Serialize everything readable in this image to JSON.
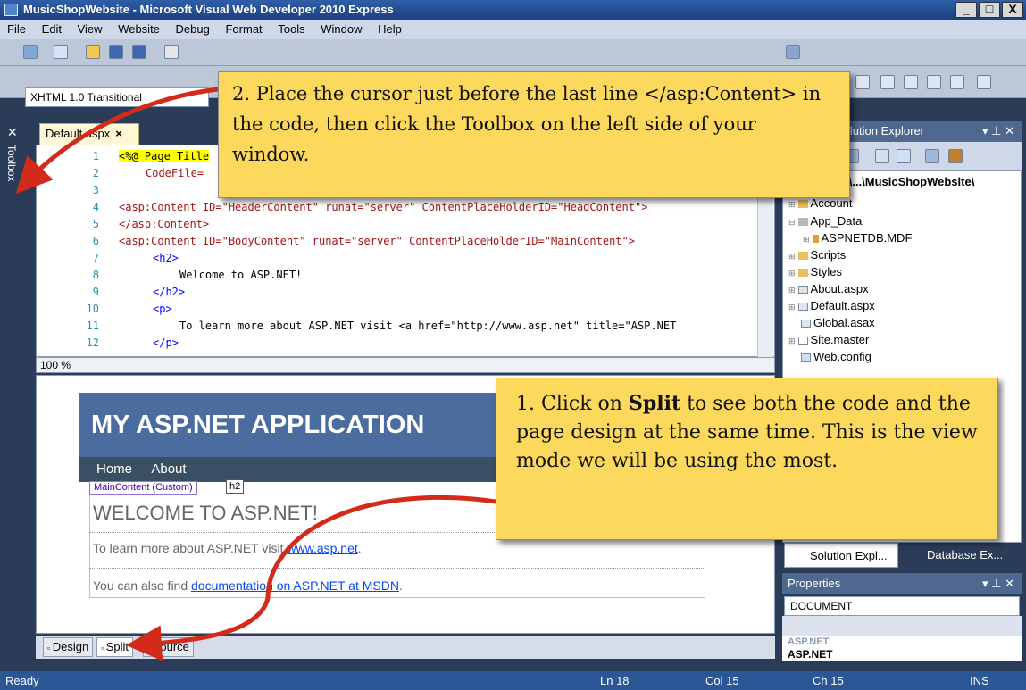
{
  "window": {
    "title": "MusicShopWebsite - Microsoft Visual Web Developer 2010 Express",
    "controls": [
      "_",
      "□",
      "X"
    ]
  },
  "menu": [
    "File",
    "Edit",
    "View",
    "Website",
    "Debug",
    "Format",
    "Tools",
    "Window",
    "Help"
  ],
  "toolbar": {
    "doctype_selected": "XHTML 1.0 Transitional"
  },
  "toolbox": {
    "label": "Toolbox"
  },
  "editor": {
    "tab_label": "Default.aspx",
    "tab_close": "×",
    "zoom": "100 %",
    "code_lines": [
      {
        "num": "1",
        "text": "<%@ Page Title"
      },
      {
        "num": "2",
        "text": "CodeFile="
      },
      {
        "num": "3",
        "text": ""
      },
      {
        "num": "4",
        "text": "<asp:Content ID=\"HeaderContent\" runat=\"server\" ContentPlaceHolderID=\"HeadContent\">"
      },
      {
        "num": "5",
        "text": "</asp:Content>"
      },
      {
        "num": "6",
        "text": "<asp:Content ID=\"BodyContent\" runat=\"server\" ContentPlaceHolderID=\"MainContent\">"
      },
      {
        "num": "7",
        "text": "<h2>"
      },
      {
        "num": "8",
        "text": "Welcome to ASP.NET!"
      },
      {
        "num": "9",
        "text": "</h2>"
      },
      {
        "num": "10",
        "text": "<p>"
      },
      {
        "num": "11",
        "text": "To learn more about ASP.NET visit <a href=\"http://www.asp.net\" title=\"ASP.NET"
      },
      {
        "num": "12",
        "text": "</p>"
      }
    ]
  },
  "design": {
    "header_title": "MY ASP.NET APPLICATION",
    "nav": [
      "Home",
      "About"
    ],
    "maincontent_label": "MainContent (Custom)",
    "h2_label": "h2",
    "welcome": "WELCOME TO ASP.NET!",
    "learn_text": "To learn more about ASP.NET visit ",
    "learn_link": "www.asp.net",
    "learn_end": ".",
    "also_text": "You can also find ",
    "also_link": "documentation on ASP.NET at MSDN",
    "also_end": "."
  },
  "view_tabs": {
    "design": "Design",
    "split": "Split",
    "source": "Source"
  },
  "solution_explorer": {
    "title": "Solution Explorer",
    "root": "C:\\...\\MusicShopWebsite\\",
    "items": [
      {
        "label": "Account",
        "icon": "folder-icon"
      },
      {
        "label": "App_Data",
        "icon": "folder-icon"
      },
      {
        "label": "ASPNETDB.MDF",
        "icon": "database-icon"
      },
      {
        "label": "Scripts",
        "icon": "folder-icon"
      },
      {
        "label": "Styles",
        "icon": "folder-icon"
      },
      {
        "label": "About.aspx",
        "icon": "page-icon"
      },
      {
        "label": "Default.aspx",
        "icon": "page-icon"
      },
      {
        "label": "Global.asax",
        "icon": "page-icon"
      },
      {
        "label": "Site.master",
        "icon": "page-icon"
      },
      {
        "label": "Web.config",
        "icon": "config-icon"
      }
    ],
    "tab_solution": "Solution Expl...",
    "tab_database": "Database Ex..."
  },
  "properties": {
    "title": "Properties",
    "selected": "DOCUMENT",
    "category": "ASP.NET"
  },
  "statusbar": {
    "status": "Ready",
    "line": "Ln 18",
    "col": "Col 15",
    "ch": "Ch 15",
    "mode": "INS"
  },
  "callouts": {
    "step2": "2. Place the cursor just before the last line </asp:Content> in the code, then click the Toolbox on the left side of your window.",
    "step1_pre": "1. Click on ",
    "step1_bold": "Split",
    "step1_post": " to see both the code and the page design at the same time. This is the view mode we will be using the most."
  },
  "colors": {
    "callout_bg": "#fcd85d",
    "arrow": "#d42a1a",
    "site_header": "#4b6c9e",
    "ide_frame": "#2b3c59"
  }
}
